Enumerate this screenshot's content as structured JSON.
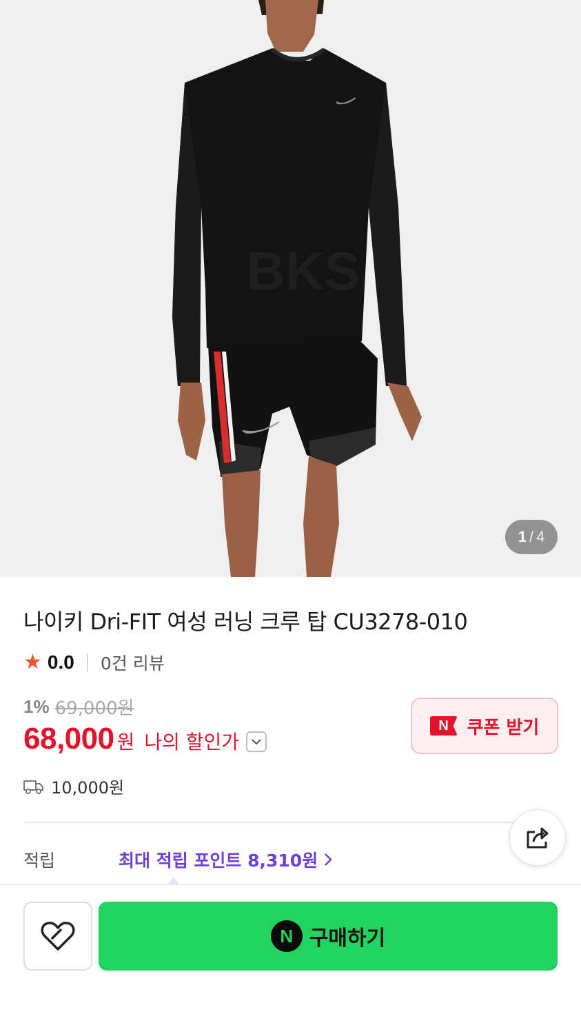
{
  "gallery": {
    "current": "1",
    "separator": "/",
    "total": "4",
    "watermark": "BKS"
  },
  "product": {
    "title": "나이키 Dri-FIT 여성 러닝 크루 탑 CU3278-010",
    "rating": "0.0",
    "reviews": "0건 리뷰",
    "discount_rate": "1%",
    "original_price": "69,000원",
    "price": "68,000",
    "price_unit": "원",
    "my_discount_label": "나의 할인가",
    "shipping_fee": "10,000원"
  },
  "coupon": {
    "badge": "N",
    "label": "쿠폰 받기"
  },
  "points": {
    "label": "적립",
    "text": "최대 적립 포인트 8,310원"
  },
  "bottom": {
    "buy_badge": "N",
    "buy_label": "구매하기"
  },
  "colors": {
    "accent_red": "#e5132a",
    "points_purple": "#6b3fe0",
    "buy_green": "#20d45d",
    "star": "#f2552c"
  },
  "icons": {
    "star": "star-icon",
    "chevron": "chevron-down-icon",
    "truck": "truck-icon",
    "share": "share-icon",
    "heart": "heart-icon",
    "points_chevron": "chevron-right-icon"
  }
}
